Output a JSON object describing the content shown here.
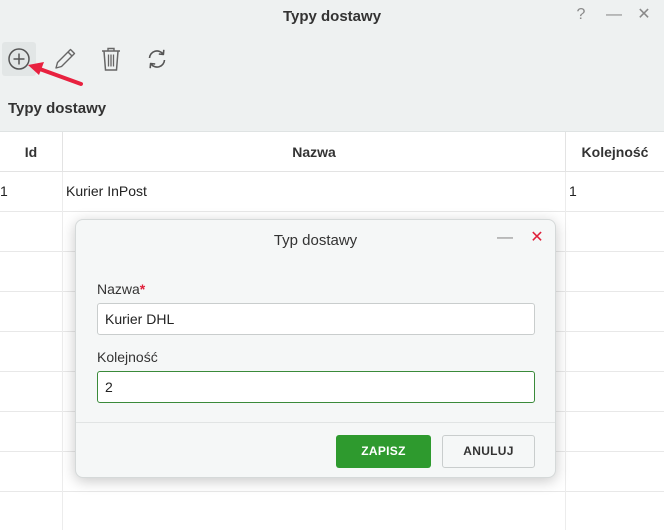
{
  "window": {
    "title": "Typy dostawy",
    "help_glyph": "?",
    "minimize_glyph": "—",
    "close_glyph": "✕"
  },
  "toolbar": {
    "icons": [
      "add-icon",
      "edit-icon",
      "delete-icon",
      "refresh-icon"
    ]
  },
  "section_title": "Typy dostawy",
  "table": {
    "columns": [
      "Id",
      "Nazwa",
      "Kolejność"
    ],
    "rows": [
      {
        "id": "1",
        "name": "Kurier InPost",
        "order": "1"
      }
    ]
  },
  "dialog": {
    "title": "Typ dostawy",
    "minimize_glyph": "—",
    "close_glyph": "✕",
    "name_label": "Nazwa",
    "required_mark": "*",
    "name_value": "Kurier DHL",
    "order_label": "Kolejność",
    "order_value": "2",
    "save_label": "ZAPISZ",
    "cancel_label": "ANULUJ"
  },
  "colors": {
    "accent_green": "#2e9a2e",
    "close_red": "#e0203a",
    "annotation_arrow": "#e8213f"
  }
}
